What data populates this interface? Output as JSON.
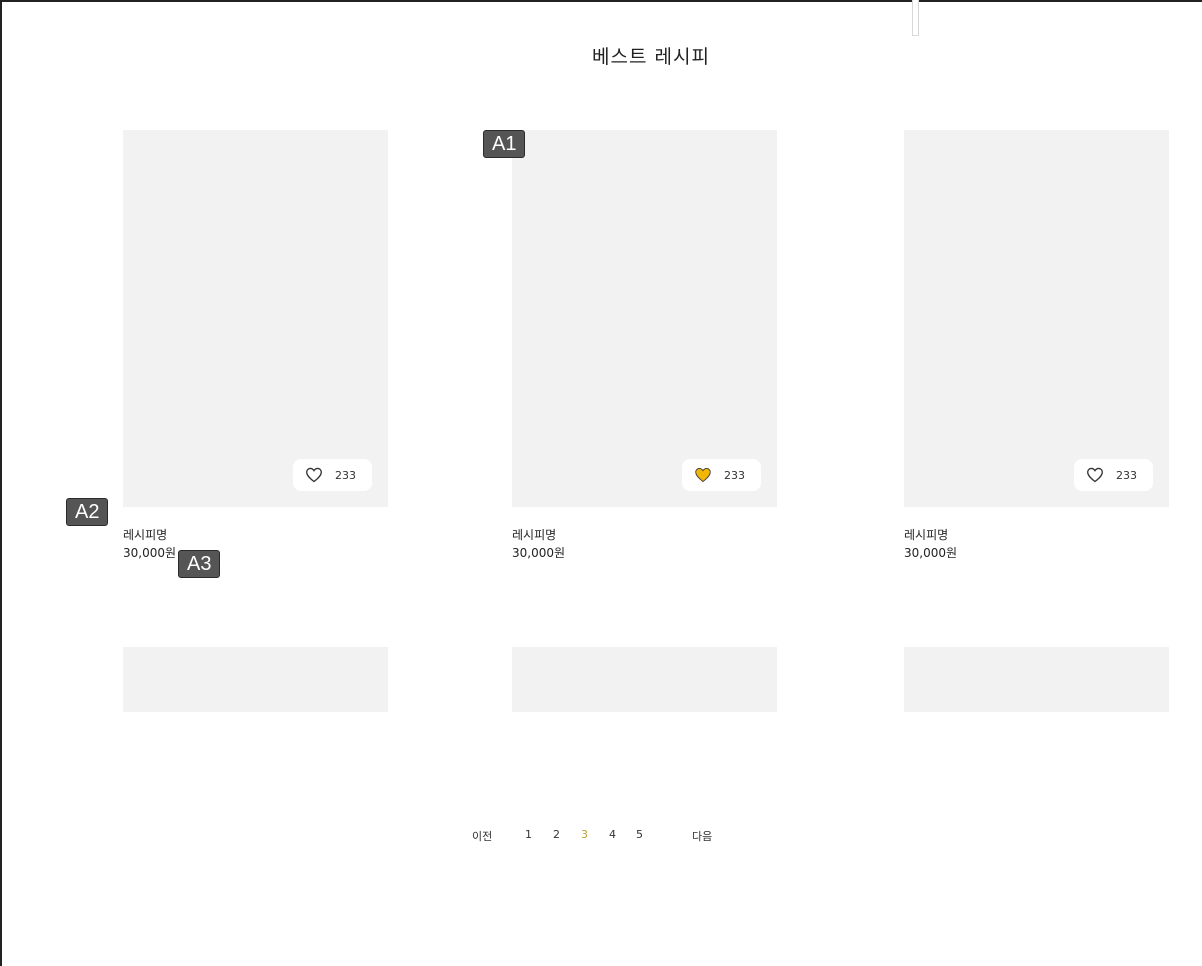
{
  "page": {
    "title": "베스트 레시피"
  },
  "colors": {
    "card_bg": "#f2f2f2",
    "liked_heart": "#f2b705",
    "current_page": "#b7a23a",
    "annotation_bg": "#555555"
  },
  "cards": [
    {
      "name": "레시피명",
      "price": "30,000원",
      "likes": "233",
      "liked": false,
      "heart_icon": "heart-outline-icon"
    },
    {
      "name": "레시피명",
      "price": "30,000원",
      "likes": "233",
      "liked": true,
      "heart_icon": "heart-filled-icon"
    },
    {
      "name": "레시피명",
      "price": "30,000원",
      "likes": "233",
      "liked": false,
      "heart_icon": "heart-outline-icon"
    }
  ],
  "pagination": {
    "prev_label": "이전",
    "next_label": "다음",
    "pages": [
      "1",
      "2",
      "3",
      "4",
      "5"
    ],
    "current": "3"
  },
  "annotations": {
    "a1": "A1",
    "a2": "A2",
    "a3": "A3"
  }
}
